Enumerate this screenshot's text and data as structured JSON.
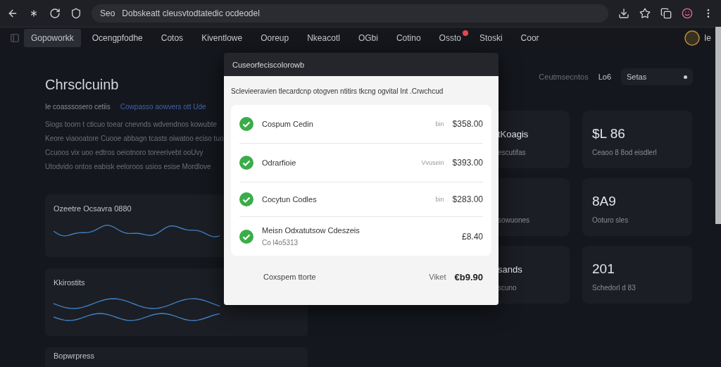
{
  "toolbar": {
    "address": "Seo",
    "url": "Dobskeatt cleusvtodtatedic ocdeodel"
  },
  "nav": {
    "tabs": [
      {
        "label": "Gopoworkk",
        "selected": true,
        "badge": false
      },
      {
        "label": "Ocengpfodhe",
        "selected": false,
        "badge": false
      },
      {
        "label": "Cotos",
        "selected": false,
        "badge": false
      },
      {
        "label": "Kiventlowe",
        "selected": false,
        "badge": false
      },
      {
        "label": "Ooreup",
        "selected": false,
        "badge": false
      },
      {
        "label": "Nkeacotl",
        "selected": false,
        "badge": false
      },
      {
        "label": "OGbi",
        "selected": false,
        "badge": false
      },
      {
        "label": "Cotino",
        "selected": false,
        "badge": false
      },
      {
        "label": "Ossto",
        "selected": false,
        "badge": true
      },
      {
        "label": "Stoski",
        "selected": false,
        "badge": false
      },
      {
        "label": "Coor",
        "selected": false,
        "badge": false
      }
    ],
    "user": "Ie"
  },
  "page": {
    "title": "Chrsclcuinb",
    "subtitle": "Ie coasssosero cetiis",
    "link": "Cowpasso aowvers ott Ude",
    "paragraph": [
      "Siogs   toorn t cticuo toear cnevnds wdvendnos  kowubte",
      "Keore viaooatore  Cuooe  abbagn  tcasts  oiwatoo  eciso  tuo",
      "Ccuoos  vix  uoo  edtros   oeiotnoro  toreerivebt  ooUvy",
      "Utodvido  ontos  eabisk  eeloroos  usios   esise  Mordlove"
    ]
  },
  "charts": [
    {
      "title": "Ozeetre Ocsavra 0880",
      "kind": "single"
    },
    {
      "title": "Kkirostits",
      "kind": "double"
    },
    {
      "title": "Bopwrpress",
      "kind": "empty"
    }
  ],
  "filters": {
    "label": "Ceutmsecntos",
    "value": "Lo6",
    "select": "Setas"
  },
  "stats": [
    {
      "value": "tKoagis",
      "caption": "escutifas"
    },
    {
      "caption": "sowuones"
    },
    {
      "value": "sands",
      "caption": "scuno"
    },
    {
      "value": "$L 86",
      "caption": "Ceaoo 8 8od eisdlerl"
    },
    {
      "value": "8A9",
      "caption": "Ooturo sles"
    },
    {
      "value": "201",
      "caption": "Schedorl d 83"
    }
  ],
  "dialog": {
    "title": "Cuseorfeciscolorowb",
    "description": "Sclevieeravien tlecardcnp otogven ntitirs tkcng ogvital Int .Crwchcud",
    "items": [
      {
        "name": "Cospum Cedin",
        "prefix": "bin",
        "price": "$358.00",
        "checked": true
      },
      {
        "name": "Odrarfioie",
        "prefix": "Vvusein",
        "price": "$393.00",
        "checked": true
      },
      {
        "name": "Cocytun Codles",
        "prefix": "bin",
        "price": "$283.00",
        "checked": true
      },
      {
        "name": "Meisn Odxatutsow Cdeszeis",
        "detail": "Co l4o5313",
        "price": "£8.40",
        "checked": true
      }
    ],
    "total": {
      "label": "Coxspem ttorte",
      "prefix": "Viket",
      "price": "€b9.90"
    }
  }
}
